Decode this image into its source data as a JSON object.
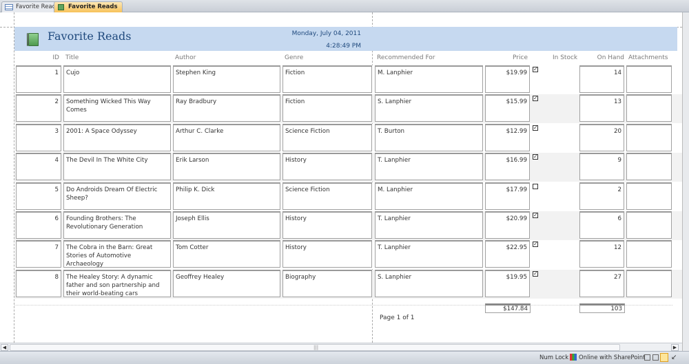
{
  "tabs": [
    {
      "label": "Favorite Reads",
      "icon": "table-icon",
      "active": false
    },
    {
      "label": "Favorite Reads",
      "icon": "report-icon",
      "active": true
    }
  ],
  "report": {
    "title": "Favorite Reads",
    "date": "Monday, July 04, 2011",
    "time": "4:28:49 PM",
    "columns": [
      "ID",
      "Title",
      "Author",
      "Genre",
      "Recommended For",
      "Price",
      "In Stock",
      "On Hand",
      "Attachments"
    ],
    "rows": [
      {
        "id": "1",
        "title": "Cujo",
        "author": "Stephen King",
        "genre": "Fiction",
        "rec": "M. Lanphier",
        "price": "$19.99",
        "in_stock": true,
        "on_hand": "14"
      },
      {
        "id": "2",
        "title": "Something Wicked This Way Comes",
        "author": "Ray Bradbury",
        "genre": "Fiction",
        "rec": "S. Lanphier",
        "price": "$15.99",
        "in_stock": true,
        "on_hand": "13"
      },
      {
        "id": "3",
        "title": "2001: A Space Odyssey",
        "author": "Arthur C. Clarke",
        "genre": "Science Fiction",
        "rec": "T. Burton",
        "price": "$12.99",
        "in_stock": true,
        "on_hand": "20"
      },
      {
        "id": "4",
        "title": "The Devil In The White City",
        "author": "Erik Larson",
        "genre": "History",
        "rec": "T. Lanphier",
        "price": "$16.99",
        "in_stock": true,
        "on_hand": "9"
      },
      {
        "id": "5",
        "title": "Do Androids Dream Of Electric Sheep?",
        "author": "Philip K. Dick",
        "genre": "Science Fiction",
        "rec": "M. Lanphier",
        "price": "$17.99",
        "in_stock": false,
        "on_hand": "2"
      },
      {
        "id": "6",
        "title": "Founding Brothers: The Revolutionary Generation",
        "author": "Joseph Ellis",
        "genre": "History",
        "rec": "T. Lanphier",
        "price": "$20.99",
        "in_stock": true,
        "on_hand": "6"
      },
      {
        "id": "7",
        "title": "The Cobra in the Barn: Great Stories of Automotive Archaeology",
        "author": "Tom Cotter",
        "genre": "History",
        "rec": "T. Lanphier",
        "price": "$22.95",
        "in_stock": true,
        "on_hand": "12"
      },
      {
        "id": "8",
        "title": "The Healey Story: A dynamic father and son partnership and their world-beating cars",
        "author": "Geoffrey Healey",
        "genre": "Biography",
        "rec": "S. Lanphier",
        "price": "$19.95",
        "in_stock": true,
        "on_hand": "27"
      }
    ],
    "total_price": "$147.84",
    "total_on_hand": "103",
    "page": "Page 1 of 1"
  },
  "status": {
    "num_lock": "Num Lock",
    "sharepoint": "Online with SharePoint"
  },
  "colors": {
    "header_band": "#c6d9f0",
    "title": "#1f497d",
    "alt_row": "#f2f2f2",
    "active_tab": "#f7c25a"
  }
}
